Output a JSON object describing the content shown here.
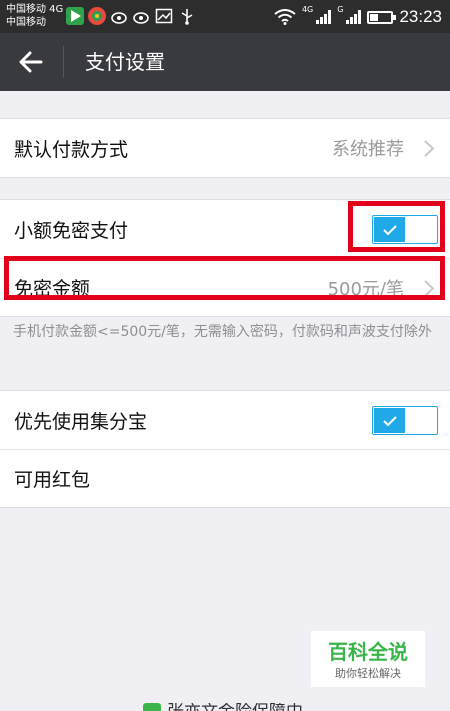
{
  "statusbar": {
    "carrier1": "中国移动 4G",
    "carrier2": "中国移动",
    "net1": "4G",
    "net2": "G",
    "time": "23:23"
  },
  "navbar": {
    "title": "支付设置"
  },
  "settings": {
    "default_payment": {
      "label": "默认付款方式",
      "value": "系统推荐"
    },
    "small_password_free": {
      "label": "小额免密支付",
      "enabled": true
    },
    "free_amount": {
      "label": "免密金额",
      "value": "500元/笔"
    },
    "note": "手机付款金额<=500元/笔，无需输入密码，付款码和声波支付除外",
    "prefer_jifenbao": {
      "label": "优先使用集分宝",
      "enabled": true
    },
    "red_packet": {
      "label": "可用红包"
    }
  },
  "watermark": {
    "title": "百科全说",
    "subtitle": "助你轻松解决"
  },
  "bottom_peek": {
    "text": "张亦文金险保障中"
  },
  "colors": {
    "accent": "#1fa9e8",
    "highlight": "#e3001b",
    "navbar": "#393a3f"
  }
}
